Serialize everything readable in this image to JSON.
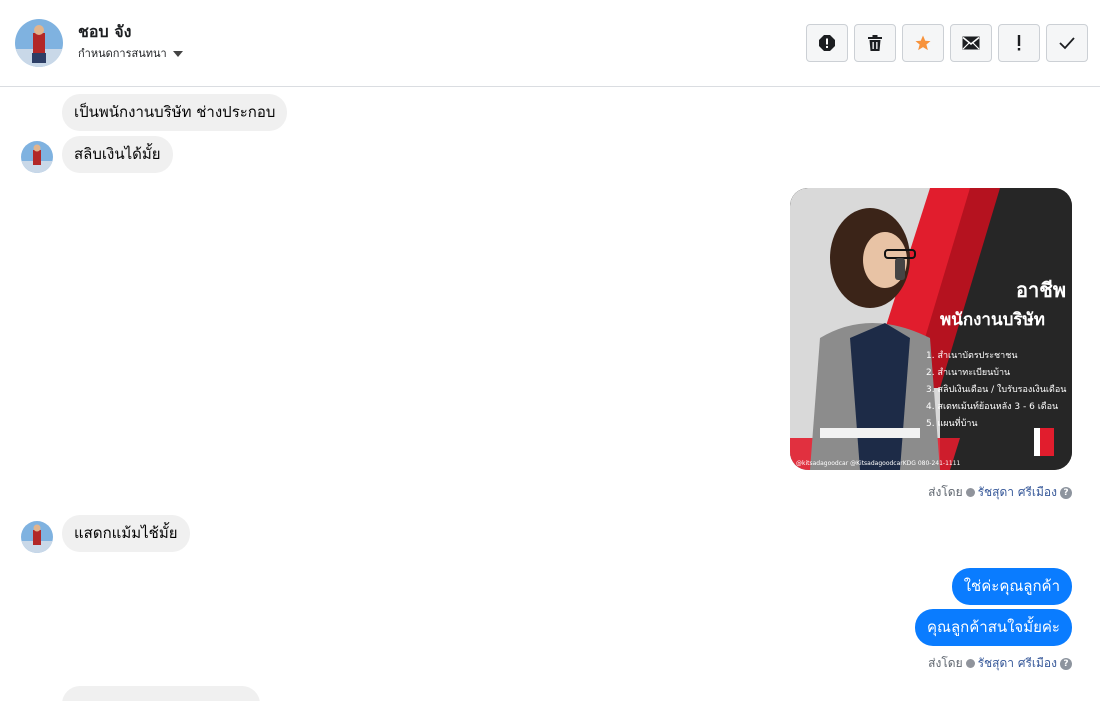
{
  "header": {
    "name": "ชอบ จัง",
    "assign_label": "กำหนดการสนทนา",
    "actions": [
      "report-icon",
      "trash-icon",
      "star-icon",
      "envelope-icon",
      "exclamation-icon",
      "check-icon"
    ]
  },
  "messages": {
    "m1": "เป็นพนักงานบริษัท ช่างประกอบ",
    "m2": "สลิบเงินได้มั้ย",
    "m3": "แสดกแม้มไช้มั้ย",
    "r1": "ใช่ค่ะคุณลูกค้า",
    "r2": "คุณลูกค้าสนใจมั้ยค่ะ"
  },
  "image_message": {
    "title1": "อาชีพ",
    "title2": "พนักงานบริษัท",
    "items": [
      "1. สำเนาบัตรประชาชน",
      "2. สำเนาทะเบียนบ้าน",
      "3. สลิปเงินเดือน / ใบรับรองเงินเดือน",
      "4. สเตทเม้นท์ย้อนหลัง 3 - 6 เดือน",
      "5. แผนที่บ้าน"
    ],
    "footer": "@kitsadagoodcar   @KitsadagoodcarKDG   080-241-1111"
  },
  "sent_by": {
    "prefix": "ส่งโดย",
    "agent": "รัชสุดา ศรีเมือง"
  },
  "colors": {
    "outgoing": "#0a7cff",
    "incoming": "#f0f0f0",
    "star": "#f7923b",
    "poster_red": "#e11d2d"
  }
}
